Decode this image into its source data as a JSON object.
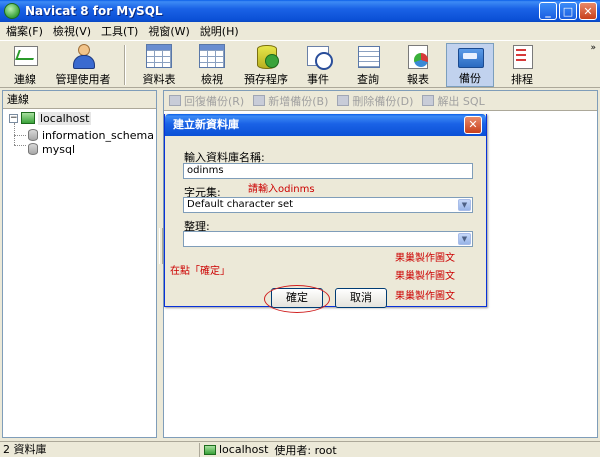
{
  "window": {
    "title": "Navicat 8 for MySQL",
    "minimize": "_",
    "maximize": "□",
    "close": "✕"
  },
  "menu": [
    "檔案(F)",
    "檢視(V)",
    "工具(T)",
    "視窗(W)",
    "說明(H)"
  ],
  "toolbar": {
    "items": [
      {
        "label": "連線",
        "icon": "connection-icon"
      },
      {
        "label": "管理使用者",
        "icon": "user-icon"
      },
      {
        "label": "資料表",
        "icon": "table-icon"
      },
      {
        "label": "檢視",
        "icon": "view-icon"
      },
      {
        "label": "預存程序",
        "icon": "stored-procedure-icon"
      },
      {
        "label": "事件",
        "icon": "event-icon"
      },
      {
        "label": "查詢",
        "icon": "query-icon"
      },
      {
        "label": "報表",
        "icon": "report-icon"
      },
      {
        "label": "備份",
        "icon": "backup-icon"
      },
      {
        "label": "排程",
        "icon": "schedule-icon"
      }
    ],
    "active": "備份",
    "overflow": "»"
  },
  "left_panel": {
    "title": "連線",
    "expander": "−",
    "server": "localhost",
    "databases": [
      "information_schema",
      "mysql"
    ]
  },
  "sub_toolbar": [
    "回復備份(R)",
    "新增備份(B)",
    "刪除備份(D)",
    "解出 SQL"
  ],
  "dialog": {
    "title": "建立新資料庫",
    "close": "✕",
    "name_label": "輸入資料庫名稱:",
    "name_value": "odinms",
    "charset_label": "字元集:",
    "charset_value": "Default character set",
    "collation_label": "整理:",
    "collation_value": "",
    "ok": "確定",
    "cancel": "取消"
  },
  "annotations": {
    "enter_name": "請輸入odinms",
    "click_ok": "在點「確定」",
    "watermark_1": "果巢製作圖文",
    "watermark_2": "果巢製作圖文",
    "watermark_3": "果巢製作圖文"
  },
  "status": {
    "left": "2 資料庫",
    "server": "localhost",
    "user": "使用者: root"
  },
  "colors": {
    "titlebar": "#0b50d6",
    "annotation": "#cc0000",
    "active_tab": "#c1d2ee"
  }
}
